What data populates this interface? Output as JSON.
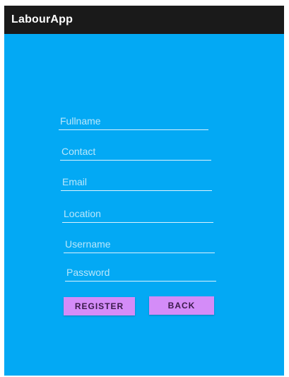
{
  "app_bar": {
    "title": "LabourApp"
  },
  "form": {
    "fields": [
      {
        "name": "fullname",
        "placeholder": "Fullname",
        "value": ""
      },
      {
        "name": "contact",
        "placeholder": "Contact",
        "value": ""
      },
      {
        "name": "email",
        "placeholder": "Email",
        "value": ""
      },
      {
        "name": "location",
        "placeholder": "Location",
        "value": ""
      },
      {
        "name": "username",
        "placeholder": "Username",
        "value": ""
      },
      {
        "name": "password",
        "placeholder": "Password",
        "value": ""
      }
    ],
    "register_label": "REGISTER",
    "back_label": "BACK"
  },
  "colors": {
    "background": "#03a9f4",
    "app_bar": "#1a1a1a",
    "button": "#d48cf8",
    "button_text": "#3a1a4a"
  }
}
